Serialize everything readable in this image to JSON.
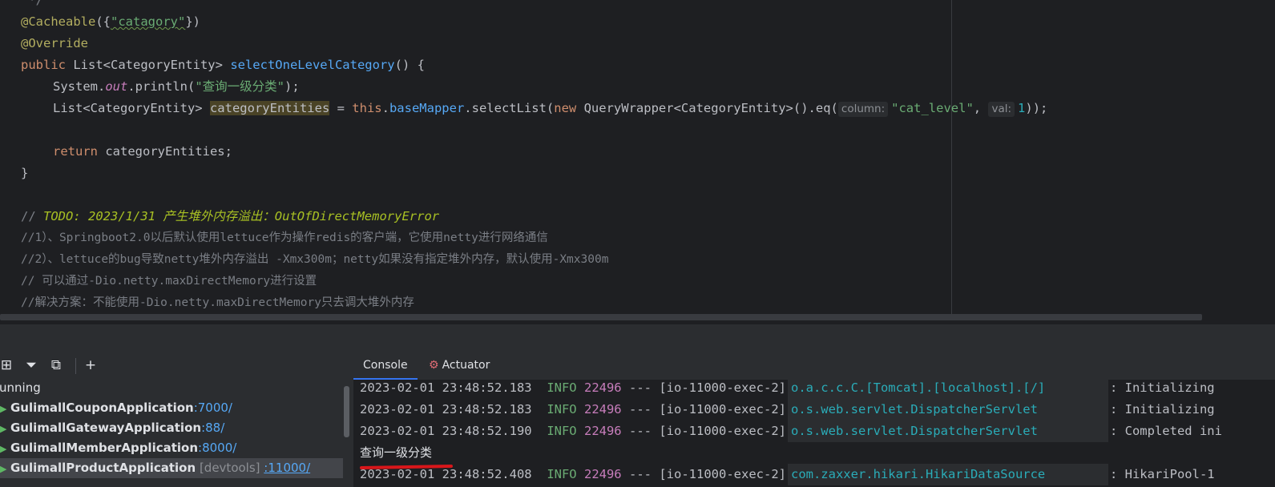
{
  "editor": {
    "line0": " */",
    "line1": {
      "ann": "@Cacheable",
      "open": "({",
      "str": "\"catagory\"",
      "close": "})"
    },
    "line2": "@Override",
    "line3": {
      "kw": "public",
      "type": " List<CategoryEntity> ",
      "fn": "selectOneLevelCategory",
      "rest": "() {"
    },
    "line4": {
      "pre": "System.",
      "out": "out",
      "mid": ".println(",
      "str": "\"查询一级分类\"",
      "end": ");"
    },
    "line5": {
      "type": "List<CategoryEntity> ",
      "var": "categoryEntities",
      "eq": " = ",
      "this": "this",
      "dot": ".",
      "mapper": "baseMapper",
      "call": ".selectList(",
      "new": "new",
      "wrapper": " QueryWrapper<CategoryEntity>().eq(",
      "hint1": "column:",
      "str": "\"cat_level\"",
      "comma": ", ",
      "hint2": "val:",
      "num": "1",
      "end": "));"
    },
    "line7": {
      "kw": "return",
      "rest": " categoryEntities;"
    },
    "line8": "}",
    "line10": {
      "slashes": "// ",
      "todo": "TODO: 2023/1/31 产生堆外内存溢出：OutOfDirectMemoryError"
    },
    "line11": "//1）、Springboot2.0以后默认使用lettuce作为操作redis的客户端，它使用netty进行网络通信",
    "line12": "//2）、lettuce的bug导致netty堆外内存溢出 -Xmx300m；netty如果没有指定堆外内存，默认使用-Xmx300m",
    "line13": "// 可以通过-Dio.netty.maxDirectMemory进行设置",
    "line14": "//解决方案：不能使用-Dio.netty.maxDirectMemory只去调大堆外内存"
  },
  "services": {
    "group_label": "unning",
    "items": [
      {
        "name": "GulimallCouponApplication",
        "port": ":7000/"
      },
      {
        "name": "GulimallGatewayApplication",
        "port": ":88/"
      },
      {
        "name": "GulimallMemberApplication",
        "port": ":8000/"
      },
      {
        "name": "GulimallProductApplication",
        "devtools": "[devtools]",
        "port": ":11000/"
      }
    ]
  },
  "console": {
    "tabs": [
      {
        "label": "Console"
      },
      {
        "label": "Actuator"
      }
    ],
    "logs": [
      {
        "ts": "2023-02-01 23:48:52.183",
        "level": "INFO",
        "pid": "22496",
        "sep": "---",
        "thread": "[io-11000-exec-2]",
        "logger": "o.a.c.c.C.[Tomcat].[localhost].[/]",
        "msg": ": Initializing"
      },
      {
        "ts": "2023-02-01 23:48:52.183",
        "level": "INFO",
        "pid": "22496",
        "sep": "---",
        "thread": "[io-11000-exec-2]",
        "logger": "o.s.web.servlet.DispatcherServlet",
        "msg": ": Initializing"
      },
      {
        "ts": "2023-02-01 23:48:52.190",
        "level": "INFO",
        "pid": "22496",
        "sep": "---",
        "thread": "[io-11000-exec-2]",
        "logger": "o.s.web.servlet.DispatcherServlet",
        "msg": ": Completed ini"
      },
      {
        "ts": "2023-02-01 23:48:52.408",
        "level": "INFO",
        "pid": "22496",
        "sep": "---",
        "thread": "[io-11000-exec-2]",
        "logger": "com.zaxxer.hikari.HikariDataSource",
        "msg": ": HikariPool-1"
      }
    ],
    "output_line": "查询一级分类"
  },
  "colors": {
    "accent": "#3574f0",
    "annotation_mark": "#d8161a"
  }
}
